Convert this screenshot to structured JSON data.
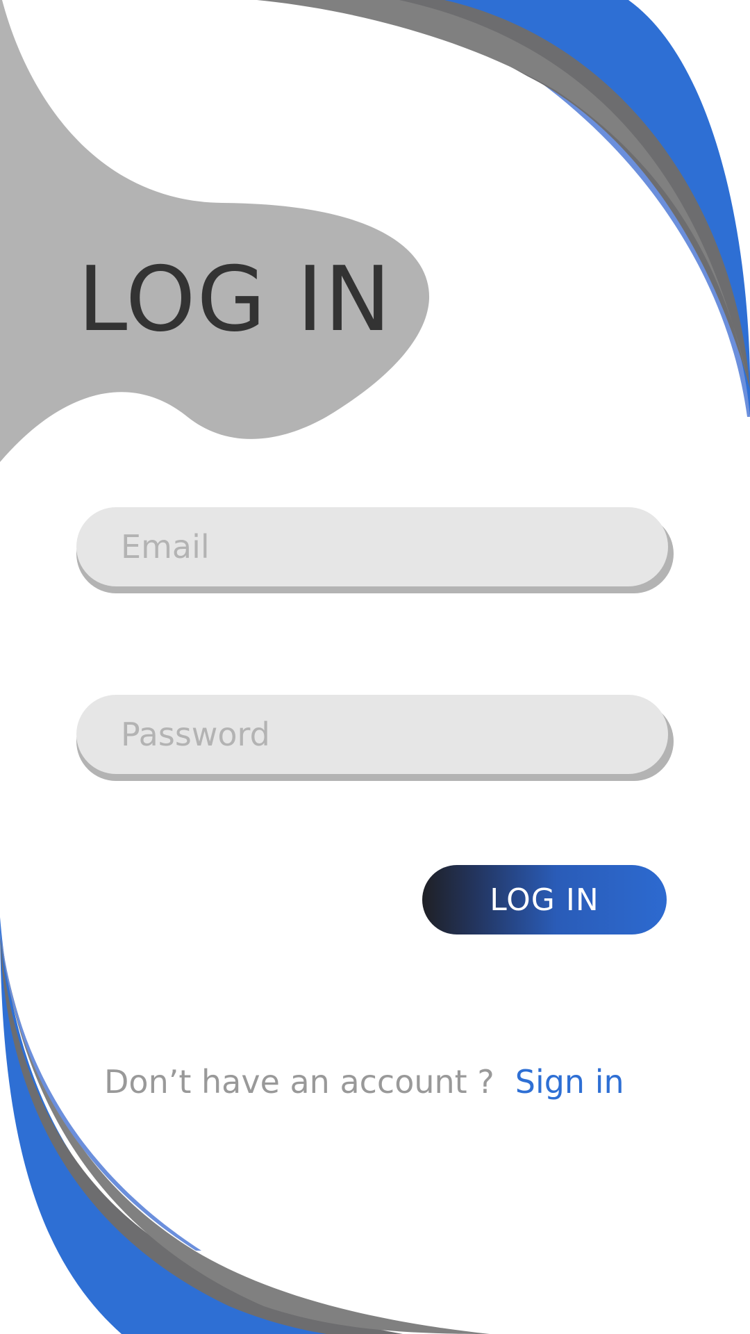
{
  "page": {
    "title": "LOG IN"
  },
  "form": {
    "email_placeholder": "Email",
    "password_placeholder": "Password",
    "submit_label": "LOG IN"
  },
  "footer": {
    "prompt": "Don’t have an account ?",
    "link_label": "Sign in"
  },
  "colors": {
    "accent_blue": "#2e6fd4",
    "light_blue": "#6b8fdc",
    "gray_blob": "#b3b3b3",
    "field_background": "#e6e6e6",
    "title_text": "#333333"
  }
}
